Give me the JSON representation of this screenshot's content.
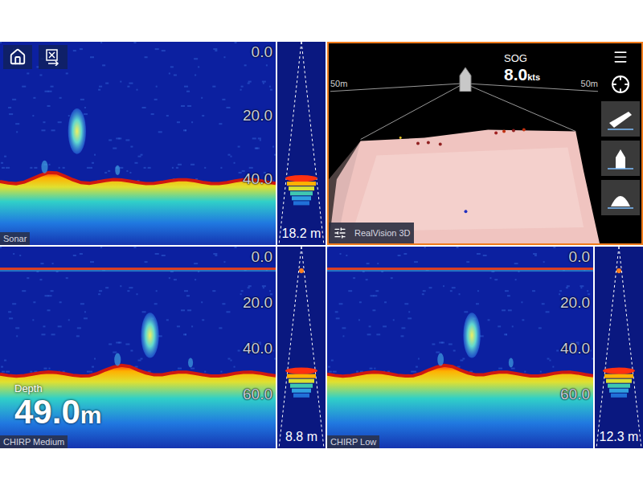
{
  "rows": [
    {
      "panes": [
        {
          "kind": "sonar",
          "label": "Sonar",
          "selected": false,
          "scale": [
            "0.0",
            "20.0",
            "40.0"
          ],
          "ascope_reading": "18.2 m"
        },
        {
          "kind": "realvision",
          "label": "RealVision 3D",
          "selected": true,
          "sog_label": "SOG",
          "sog_value": "8.0",
          "sog_unit": "kts",
          "range_labels": [
            "50m",
            "50m"
          ]
        }
      ]
    },
    {
      "panes": [
        {
          "kind": "sonar",
          "label": "CHIRP Medium",
          "selected": false,
          "scale": [
            "0.0",
            "20.0",
            "40.0",
            "60.0"
          ],
          "ascope_reading": "8.8 m",
          "depth": {
            "label": "Depth",
            "value": "49.0",
            "unit": "m"
          }
        },
        {
          "kind": "sonar",
          "label": "CHIRP Low",
          "selected": false,
          "scale": [
            "0.0",
            "20.0",
            "40.0",
            "60.0"
          ],
          "ascope_reading": "12.3 m"
        }
      ]
    }
  ]
}
